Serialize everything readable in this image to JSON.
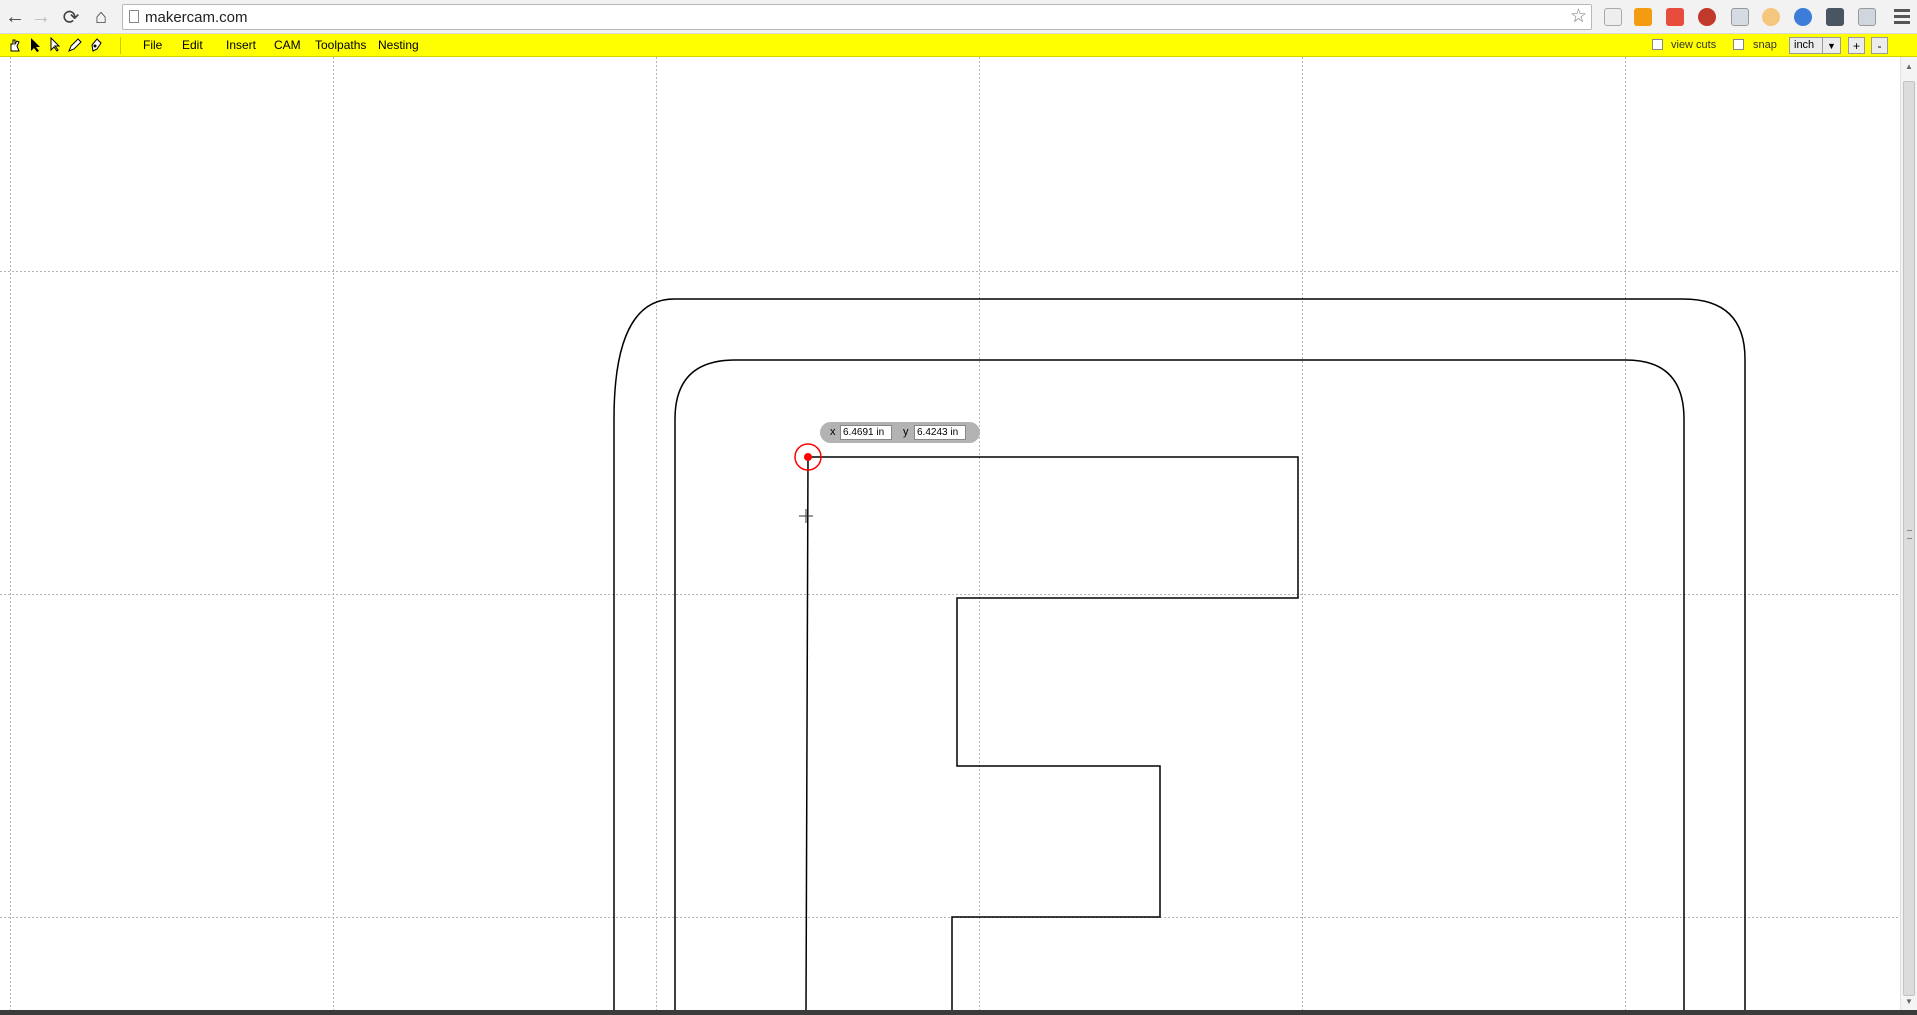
{
  "browser": {
    "url": "makercam.com",
    "nav": {
      "back_icon": "←",
      "forward_icon": "→",
      "reload_icon": "⟳",
      "home_icon": "⌂"
    },
    "star_icon": "☆"
  },
  "toolbar": {
    "menus": [
      "File",
      "Edit",
      "Insert",
      "CAM",
      "Toolpaths",
      "Nesting"
    ],
    "view_cuts_label": "view cuts",
    "snap_label": "snap",
    "unit": "inch",
    "zoom_in_label": "+",
    "zoom_out_label": "-"
  },
  "coordinates": {
    "x_label": "x",
    "y_label": "y",
    "x_value": "6.4691 in",
    "y_value": "6.4243 in"
  },
  "colors": {
    "toolbar": "#ffff00",
    "selected_point": "#ff0000",
    "path_stroke": "#000000",
    "grid": "#b4b4b4"
  }
}
